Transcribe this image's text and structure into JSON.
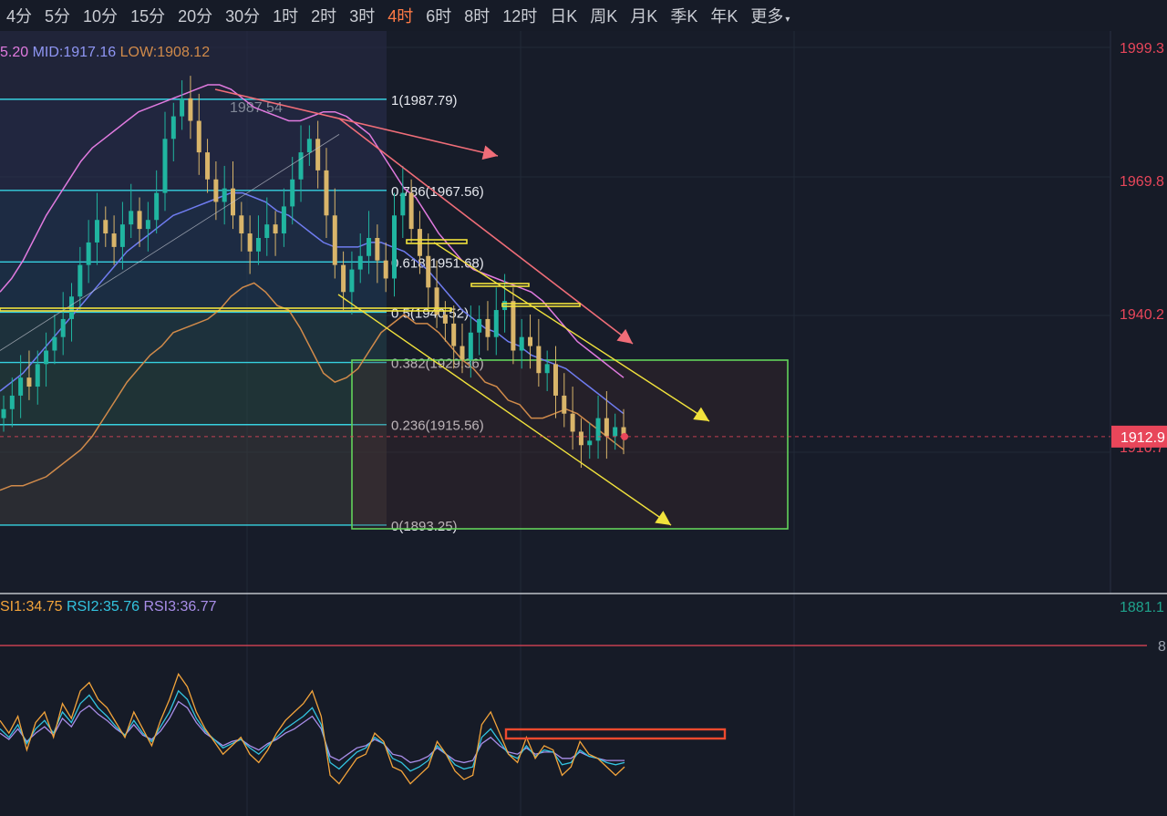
{
  "toolbar": {
    "timeframes": [
      "4分",
      "5分",
      "10分",
      "15分",
      "20分",
      "30分",
      "1时",
      "2时",
      "3时",
      "4时",
      "6时",
      "8时",
      "12时",
      "日K",
      "周K",
      "月K",
      "季K",
      "年K",
      "更多"
    ],
    "active": "4时"
  },
  "colors": {
    "bg": "#161b27",
    "fib": "#36d1e0",
    "upper_band": "#e07adf",
    "mid_band": "#6f7cf0",
    "lower_band": "#d08a4a",
    "down_arrow_red": "#f06d78",
    "channel_yellow": "#f1e23c",
    "green_box": "#63d35a",
    "red_box": "#ee4a2e",
    "price_tag": "#e8465a",
    "axis_red": "#e8465a",
    "axis_green": "#1fa38c",
    "rsi1": "#f3a43b",
    "rsi2": "#33c4e0",
    "rsi3": "#a98ee9",
    "rsi_line": "#e8465a"
  },
  "boll_legend": {
    "up_fragment": "5.20",
    "mid": "MID:1917.16",
    "low": "LOW:1908.12"
  },
  "rsi_legend": {
    "rsi1": "SI1:34.75",
    "rsi2": "RSI2:35.76",
    "rsi3": "RSI3:36.77"
  },
  "rsi_level_label": "8",
  "chart_data": {
    "type": "candlestick",
    "instrument_timeframe": "4时",
    "price_axis": {
      "ticks": [
        "1999.3",
        "1969.8",
        "1940.2",
        "1910.7",
        "1881.1"
      ],
      "tick_values": [
        1999.3,
        1969.8,
        1940.2,
        1910.7,
        1881.1
      ],
      "ylim": [
        1881.1,
        1999.3
      ]
    },
    "last_price": {
      "label": "1912.9",
      "value": 1912.9
    },
    "high_marker": {
      "label": "1987.54",
      "value": 1987.54
    },
    "fibonacci": [
      {
        "label": "1(1987.79)",
        "value": 1987.79
      },
      {
        "label": "0.786(1967.56)",
        "value": 1967.56
      },
      {
        "label": "0.618(1951.68)",
        "value": 1951.68
      },
      {
        "label": "0.5(1940.52)",
        "value": 1940.52
      },
      {
        "label": "0.382(1929.36)",
        "value": 1929.36
      },
      {
        "label": "0.236(1915.56)",
        "value": 1915.56
      },
      {
        "label": "0(1893.25)",
        "value": 1893.25
      }
    ],
    "close": [
      1919,
      1922,
      1926,
      1924,
      1929,
      1932,
      1935,
      1939,
      1944,
      1951,
      1956,
      1961,
      1958,
      1955,
      1960,
      1963,
      1959,
      1961,
      1967,
      1979,
      1984,
      1988,
      1983,
      1976,
      1970,
      1965,
      1968,
      1962,
      1958,
      1954,
      1957,
      1960,
      1958,
      1964,
      1970,
      1976,
      1979,
      1972,
      1962,
      1951,
      1945,
      1950,
      1953,
      1957,
      1952,
      1948,
      1962,
      1967,
      1959,
      1953,
      1946,
      1940,
      1938,
      1933,
      1930,
      1936,
      1939,
      1935,
      1941,
      1943,
      1932,
      1935,
      1933,
      1927,
      1929,
      1922,
      1918,
      1914,
      1911,
      1912,
      1917,
      1913,
      1915,
      1913
    ],
    "boll": {
      "upper": [
        1945,
        1948,
        1952,
        1957,
        1962,
        1966,
        1970,
        1974,
        1977,
        1979,
        1981,
        1983,
        1985,
        1986,
        1987,
        1988,
        1989,
        1990,
        1991,
        1991,
        1990,
        1988,
        1986,
        1985,
        1984,
        1983,
        1983,
        1984,
        1985,
        1985,
        1984,
        1982,
        1980,
        1976,
        1972,
        1968,
        1966,
        1962,
        1958,
        1955,
        1952,
        1950,
        1949,
        1948,
        1947,
        1946,
        1945,
        1943,
        1940,
        1937,
        1934,
        1932,
        1930,
        1928,
        1926
      ],
      "mid": [
        1923,
        1925,
        1927,
        1930,
        1933,
        1936,
        1939,
        1942,
        1945,
        1948,
        1951,
        1954,
        1956,
        1958,
        1960,
        1962,
        1963,
        1964,
        1965,
        1966,
        1967,
        1967,
        1966,
        1965,
        1963,
        1962,
        1960,
        1958,
        1956,
        1955,
        1955,
        1955,
        1956,
        1956,
        1955,
        1954,
        1952,
        1950,
        1947,
        1944,
        1941,
        1939,
        1937,
        1936,
        1934,
        1933,
        1931,
        1930,
        1929,
        1928,
        1926,
        1924,
        1922,
        1920,
        1918
      ],
      "lower": [
        1901,
        1902,
        1902,
        1903,
        1904,
        1906,
        1908,
        1910,
        1913,
        1917,
        1921,
        1925,
        1928,
        1931,
        1933,
        1936,
        1937,
        1938,
        1939,
        1941,
        1944,
        1946,
        1947,
        1945,
        1942,
        1941,
        1937,
        1932,
        1927,
        1925,
        1926,
        1928,
        1932,
        1936,
        1938,
        1940,
        1938,
        1938,
        1936,
        1933,
        1930,
        1928,
        1925,
        1924,
        1921,
        1920,
        1917,
        1917,
        1918,
        1919,
        1918,
        1916,
        1914,
        1912,
        1910
      ]
    },
    "rsi": {
      "rsi1": [
        56,
        50,
        58,
        42,
        55,
        60,
        48,
        64,
        57,
        70,
        74,
        66,
        62,
        55,
        48,
        60,
        52,
        44,
        56,
        66,
        78,
        72,
        60,
        52,
        46,
        40,
        44,
        48,
        40,
        36,
        42,
        50,
        56,
        60,
        64,
        70,
        58,
        30,
        26,
        32,
        38,
        40,
        50,
        46,
        34,
        32,
        26,
        30,
        34,
        46,
        40,
        32,
        28,
        30,
        54,
        60,
        50,
        40,
        36,
        48,
        38,
        44,
        42,
        30,
        34,
        46,
        40,
        38,
        34,
        30,
        34
      ],
      "rsi2": [
        52,
        48,
        54,
        45,
        52,
        56,
        50,
        60,
        55,
        64,
        68,
        62,
        58,
        53,
        49,
        56,
        50,
        46,
        53,
        60,
        70,
        66,
        57,
        51,
        47,
        43,
        45,
        47,
        43,
        40,
        44,
        48,
        52,
        55,
        58,
        62,
        54,
        36,
        33,
        37,
        41,
        43,
        48,
        45,
        38,
        36,
        32,
        34,
        37,
        44,
        40,
        35,
        33,
        34,
        48,
        52,
        46,
        40,
        38,
        44,
        39,
        42,
        41,
        35,
        36,
        42,
        39,
        38,
        36,
        35,
        36
      ],
      "rsi3": [
        50,
        47,
        52,
        46,
        50,
        53,
        49,
        57,
        53,
        60,
        63,
        59,
        56,
        52,
        49,
        54,
        49,
        47,
        51,
        57,
        65,
        62,
        55,
        50,
        47,
        44,
        46,
        47,
        44,
        42,
        45,
        47,
        50,
        52,
        55,
        58,
        52,
        39,
        37,
        40,
        43,
        44,
        47,
        45,
        40,
        39,
        36,
        37,
        39,
        43,
        40,
        37,
        36,
        37,
        45,
        48,
        44,
        41,
        40,
        43,
        40,
        41,
        41,
        38,
        38,
        41,
        39,
        38,
        37,
        37,
        37
      ]
    },
    "rsi_upper_level": 80,
    "drawings": [
      "down-trend arrows",
      "descending yellow channel",
      "green target box",
      "red RSI resistance box",
      "fibonacci retracement"
    ]
  }
}
